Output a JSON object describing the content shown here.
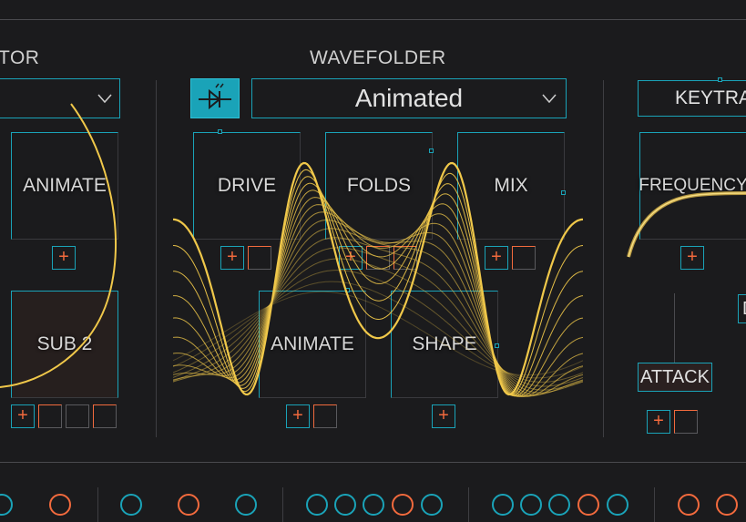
{
  "sections": {
    "left_title": "TOR",
    "wavefolder_title": "WAVEFOLDER",
    "right_title_box": "KEYTRA"
  },
  "wavefolder": {
    "mode_value": "Animated",
    "knobs": {
      "drive": "DRIVE",
      "folds": "FOLDS",
      "mix": "MIX",
      "animate": "ANIMATE",
      "shape": "SHAPE"
    }
  },
  "left": {
    "knobs": {
      "animate": "ANIMATE",
      "sub2": "SUB 2"
    }
  },
  "right": {
    "knobs": {
      "frequency": "FREQUENCY",
      "attack": "ATTACK"
    },
    "edge_letter": "D"
  },
  "mod": {
    "add_symbol": "+"
  },
  "icons": {
    "bypass": "diode-bypass-icon",
    "chevron": "chevron-down-icon"
  },
  "colors": {
    "accent": "#1aa3b8",
    "modulation": "#f26a3d",
    "waveform": "#f0c84a",
    "background": "#1b1b1d"
  }
}
